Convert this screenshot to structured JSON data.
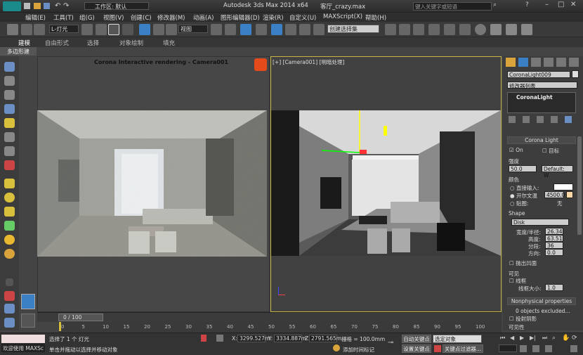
{
  "titlebar": {
    "workspace_label": "工作区: 默认",
    "app_title": "Autodesk 3ds Max  2014 x64",
    "file_name": "客厅_crazy.max",
    "search_placeholder": "键入关键字或短语"
  },
  "menu": {
    "items": [
      "编辑(E)",
      "工具(T)",
      "组(G)",
      "视图(V)",
      "创建(C)",
      "修改器(M)",
      "动画(A)",
      "图形编辑器(D)",
      "渲染(R)",
      "自定义(U)",
      "MAXScript(X)",
      "帮助(H)"
    ]
  },
  "toolbar": {
    "filter_value": "L-灯光",
    "coord_value": "视图",
    "selection_set_placeholder": "创建选择集"
  },
  "ribbon": {
    "tabs": [
      "建模",
      "自由形式",
      "选择",
      "对象绘制",
      "填充"
    ],
    "subtab": "多边形建模"
  },
  "viewport_left": {
    "title": "Corona Interactive rendering - Camera001"
  },
  "viewport_right": {
    "label": "[+] [Camera001] [明暗处理]"
  },
  "panel": {
    "object_name": "CoronaLight009",
    "modifier_list": "修改器列表",
    "stack_item": "CoronaLight",
    "rollout_title": "Corona Light",
    "on_label": "On",
    "target_label": "目标",
    "intensity_label": "强度",
    "intensity_value": "50.0",
    "intensity_unit": "Default: W",
    "color_label": "颜色",
    "direct_input_label": "直接输入:",
    "kelvin_label": "开尔文温",
    "kelvin_value": "4500.0",
    "map_label": "贴图:",
    "map_value": "无",
    "shape_label": "Shape",
    "shape_value": "Disk",
    "width_label": "宽度/半径:",
    "width_value": "26.34",
    "height_label": "高度:",
    "height_value": "63.51",
    "segments_label": "分段:",
    "segments_value": "36",
    "direction_label": "方向:",
    "direction_value": "0.0",
    "occlude_label": "抛出凹面",
    "visible_label": "可见",
    "wire_label": "线框",
    "wire_size_label": "线框大小:",
    "wire_size_value": "1.0",
    "nonphysical_title": "Nonphysical properties",
    "objects_excluded": "0 objects excluded...",
    "cast_shadow_label": "投射阴影",
    "extra_label": "可见性"
  },
  "timeline": {
    "frame_label": "0 / 100",
    "ticks": [
      "0",
      "5",
      "10",
      "15",
      "20",
      "25",
      "30",
      "35",
      "40",
      "45",
      "50",
      "55",
      "60",
      "65",
      "70",
      "75",
      "80",
      "85",
      "90",
      "95",
      "100"
    ]
  },
  "status": {
    "welcome": "欢迎使用 MAXSc",
    "selected": "选择了 1 个 灯光",
    "prompt": "单击并拖动以选择并移动对象",
    "x_label": "X:",
    "x_value": "3299.527m",
    "y_label": "Y:",
    "y_value": "3334.887m",
    "z_label": "Z:",
    "z_value": "2791.565m",
    "grid": "栅格 = 100.0mm",
    "add_time_tag": "添加时间标记",
    "auto_key": "自动关键点",
    "set_key": "设置关键点",
    "selected_obj": "选定对象",
    "key_filters": "关键点过滤器..."
  },
  "colors": {
    "accent": "#c8b44a",
    "render_bg": "#9a9a94",
    "active_btn": "#3b7fc4"
  }
}
